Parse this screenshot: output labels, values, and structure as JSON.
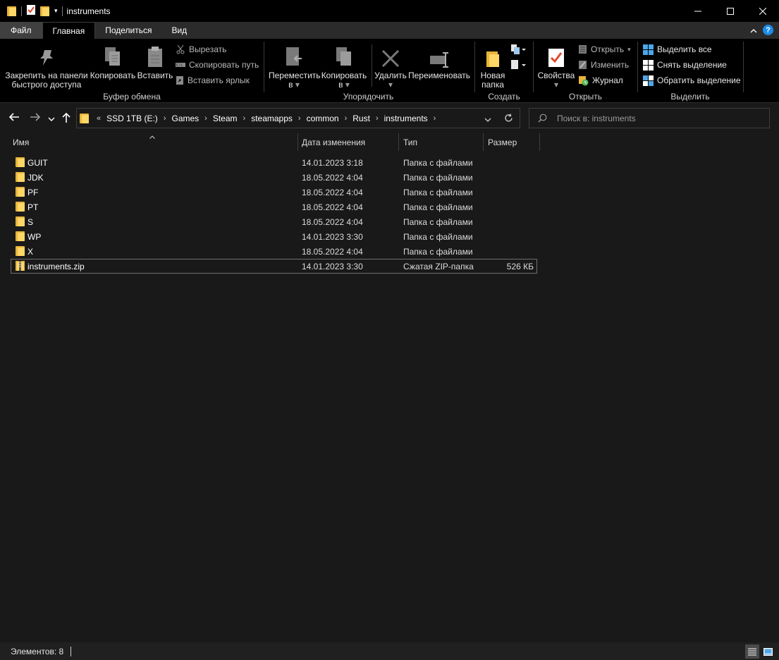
{
  "window": {
    "title": "instruments"
  },
  "tabs": [
    {
      "label": "Файл"
    },
    {
      "label": "Главная"
    },
    {
      "label": "Поделиться"
    },
    {
      "label": "Вид"
    }
  ],
  "ribbon": {
    "clipboard": {
      "label": "Буфер обмена",
      "pin_line1": "Закрепить на панели",
      "pin_line2": "быстрого доступа",
      "copy": "Копировать",
      "paste": "Вставить",
      "cut": "Вырезать",
      "copy_path": "Скопировать путь",
      "paste_shortcut": "Вставить ярлык"
    },
    "organize": {
      "label": "Упорядочить",
      "move_line1": "Переместить",
      "move_line2": "в",
      "copyto_line1": "Копировать",
      "copyto_line2": "в",
      "delete": "Удалить",
      "rename": "Переименовать"
    },
    "create": {
      "label": "Создать",
      "new_folder_line1": "Новая",
      "new_folder_line2": "папка"
    },
    "open": {
      "label": "Открыть",
      "properties": "Свойства",
      "open": "Открыть",
      "edit": "Изменить",
      "history": "Журнал"
    },
    "select": {
      "label": "Выделить",
      "select_all": "Выделить все",
      "select_none": "Снять выделение",
      "invert": "Обратить выделение"
    }
  },
  "address": {
    "overflow": "«",
    "crumbs": [
      "SSD 1TB (E:)",
      "Games",
      "Steam",
      "steamapps",
      "common",
      "Rust",
      "instruments"
    ]
  },
  "search": {
    "placeholder": "Поиск в: instruments"
  },
  "columns": {
    "name": "Имя",
    "date": "Дата изменения",
    "type": "Тип",
    "size": "Размер"
  },
  "files": [
    {
      "name": "GUIT",
      "date": "14.01.2023 3:18",
      "type": "Папка с файлами",
      "size": "",
      "kind": "folder"
    },
    {
      "name": "JDK",
      "date": "18.05.2022 4:04",
      "type": "Папка с файлами",
      "size": "",
      "kind": "folder"
    },
    {
      "name": "PF",
      "date": "18.05.2022 4:04",
      "type": "Папка с файлами",
      "size": "",
      "kind": "folder"
    },
    {
      "name": "PT",
      "date": "18.05.2022 4:04",
      "type": "Папка с файлами",
      "size": "",
      "kind": "folder"
    },
    {
      "name": "S",
      "date": "18.05.2022 4:04",
      "type": "Папка с файлами",
      "size": "",
      "kind": "folder"
    },
    {
      "name": "WP",
      "date": "14.01.2023 3:30",
      "type": "Папка с файлами",
      "size": "",
      "kind": "folder"
    },
    {
      "name": "X",
      "date": "18.05.2022 4:04",
      "type": "Папка с файлами",
      "size": "",
      "kind": "folder"
    },
    {
      "name": "instruments.zip",
      "date": "14.01.2023 3:30",
      "type": "Сжатая ZIP-папка",
      "size": "526 КБ",
      "kind": "zip"
    }
  ],
  "status": {
    "items": "Элементов: 8"
  },
  "colors": {
    "accent": "#1c8be8",
    "folder": "#ffd766",
    "background": "#191919"
  }
}
